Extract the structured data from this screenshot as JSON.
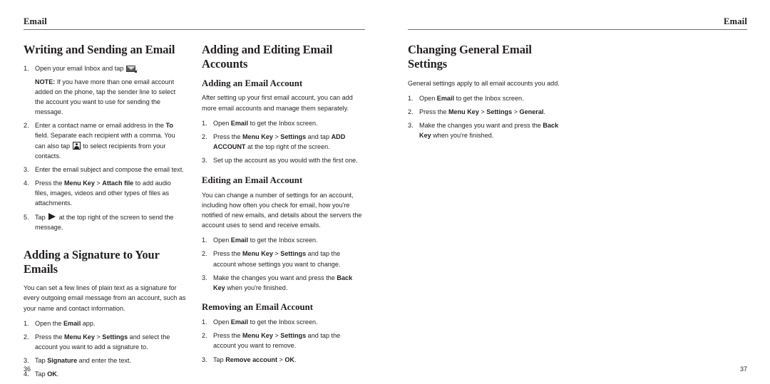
{
  "spread": {
    "left_page": {
      "running_header": "Email",
      "folio": "36",
      "columns": [
        {
          "sections": [
            {
              "heading": "Writing and Sending an Email",
              "steps": [
                {
                  "pre": "Open your email Inbox and tap ",
                  "icon": "envelope-icon",
                  "post": ".",
                  "note_label": "NOTE:",
                  "note_text": " If you have more than one email account added on the phone, tap the sender line to select the account you want to use for sending the message."
                },
                {
                  "pre": "Enter a contact name or email address in the ",
                  "bold1": "To",
                  "mid": " field. Separate each recipient with a comma. You can also tap ",
                  "icon": "contact-picker-icon",
                  "post": " to select recipients from your contacts."
                },
                {
                  "pre": "Enter the email subject and compose the email text."
                },
                {
                  "pre": "Press the ",
                  "bold1": "Menu Key",
                  "sep": " > ",
                  "bold2": "Attach file",
                  "post": " to add audio files, images, videos and other types of files as attachments."
                },
                {
                  "pre": "Tap ",
                  "icon": "send-arrow-icon",
                  "post": " at the top right of the screen to send the message."
                }
              ]
            },
            {
              "heading": "Adding a Signature to Your Emails",
              "intro": "You can set a few lines of plain text as a signature for every outgoing email message from an account, such as your name and contact information.",
              "steps": [
                {
                  "pre": "Open the ",
                  "bold1": "Email",
                  "post": " app."
                },
                {
                  "pre": "Press the ",
                  "bold1": "Menu Key",
                  "sep": " > ",
                  "bold2": "Settings",
                  "post": " and select the account you want to add a signature to."
                },
                {
                  "pre": "Tap ",
                  "bold1": "Signature",
                  "post": " and enter the text."
                },
                {
                  "pre": "Tap ",
                  "bold1": "OK",
                  "post": "."
                }
              ]
            }
          ]
        },
        {
          "sections": [
            {
              "heading": "Adding and Editing Email Accounts",
              "subsections": [
                {
                  "subheading": "Adding an Email Account",
                  "intro": "After setting up your first email account, you can add more email accounts and manage them separately.",
                  "steps": [
                    {
                      "pre": "Open ",
                      "bold1": "Email",
                      "post": " to get the Inbox screen."
                    },
                    {
                      "pre": "Press the ",
                      "bold1": "Menu Key",
                      "sep": " > ",
                      "bold2": "Settings",
                      "mid2": " and tap ",
                      "bold3": "ADD ACCOUNT",
                      "post": " at the top right of the screen."
                    },
                    {
                      "pre": "Set up the account as you would with the first one."
                    }
                  ]
                },
                {
                  "subheading": "Editing an Email Account",
                  "intro": "You can change a number of settings for an account, including how often you check for email, how you're notified of new emails, and details about the servers the account uses to send and receive emails.",
                  "steps": [
                    {
                      "pre": "Open ",
                      "bold1": "Email",
                      "post": " to get the Inbox screen."
                    },
                    {
                      "pre": "Press the ",
                      "bold1": "Menu Key",
                      "sep": " > ",
                      "bold2": "Settings",
                      "post": " and tap the account whose settings you want to change."
                    },
                    {
                      "pre": "Make the changes you want and press the ",
                      "bold1": "Back Key",
                      "post": " when you're finished."
                    }
                  ]
                },
                {
                  "subheading": "Removing an Email Account",
                  "steps": [
                    {
                      "pre": "Open ",
                      "bold1": "Email",
                      "post": " to get the Inbox screen."
                    },
                    {
                      "pre": "Press the ",
                      "bold1": "Menu Key",
                      "sep": " > ",
                      "bold2": "Settings",
                      "post": " and tap the account you want to remove."
                    },
                    {
                      "pre": "Tap ",
                      "bold1": "Remove account",
                      "sep": " > ",
                      "bold2": "OK",
                      "post": "."
                    }
                  ]
                }
              ]
            }
          ]
        }
      ]
    },
    "right_page": {
      "running_header": "Email",
      "folio": "37",
      "sections": [
        {
          "heading": "Changing General Email Settings",
          "intro": "General settings apply to all email accounts you add.",
          "steps": [
            {
              "pre": "Open ",
              "bold1": "Email",
              "post": " to get the Inbox screen."
            },
            {
              "pre": "Press the ",
              "bold1": "Menu Key",
              "sep": " > ",
              "bold2": "Settings",
              "sep2": " > ",
              "bold3": "General",
              "post": "."
            },
            {
              "pre": "Make the changes you want and press the ",
              "bold1": "Back Key",
              "post": " when you're finished."
            }
          ]
        }
      ]
    }
  },
  "colors": {
    "text": "#231f20",
    "rule": "#6d6e71",
    "page_background": "#ffffff"
  }
}
